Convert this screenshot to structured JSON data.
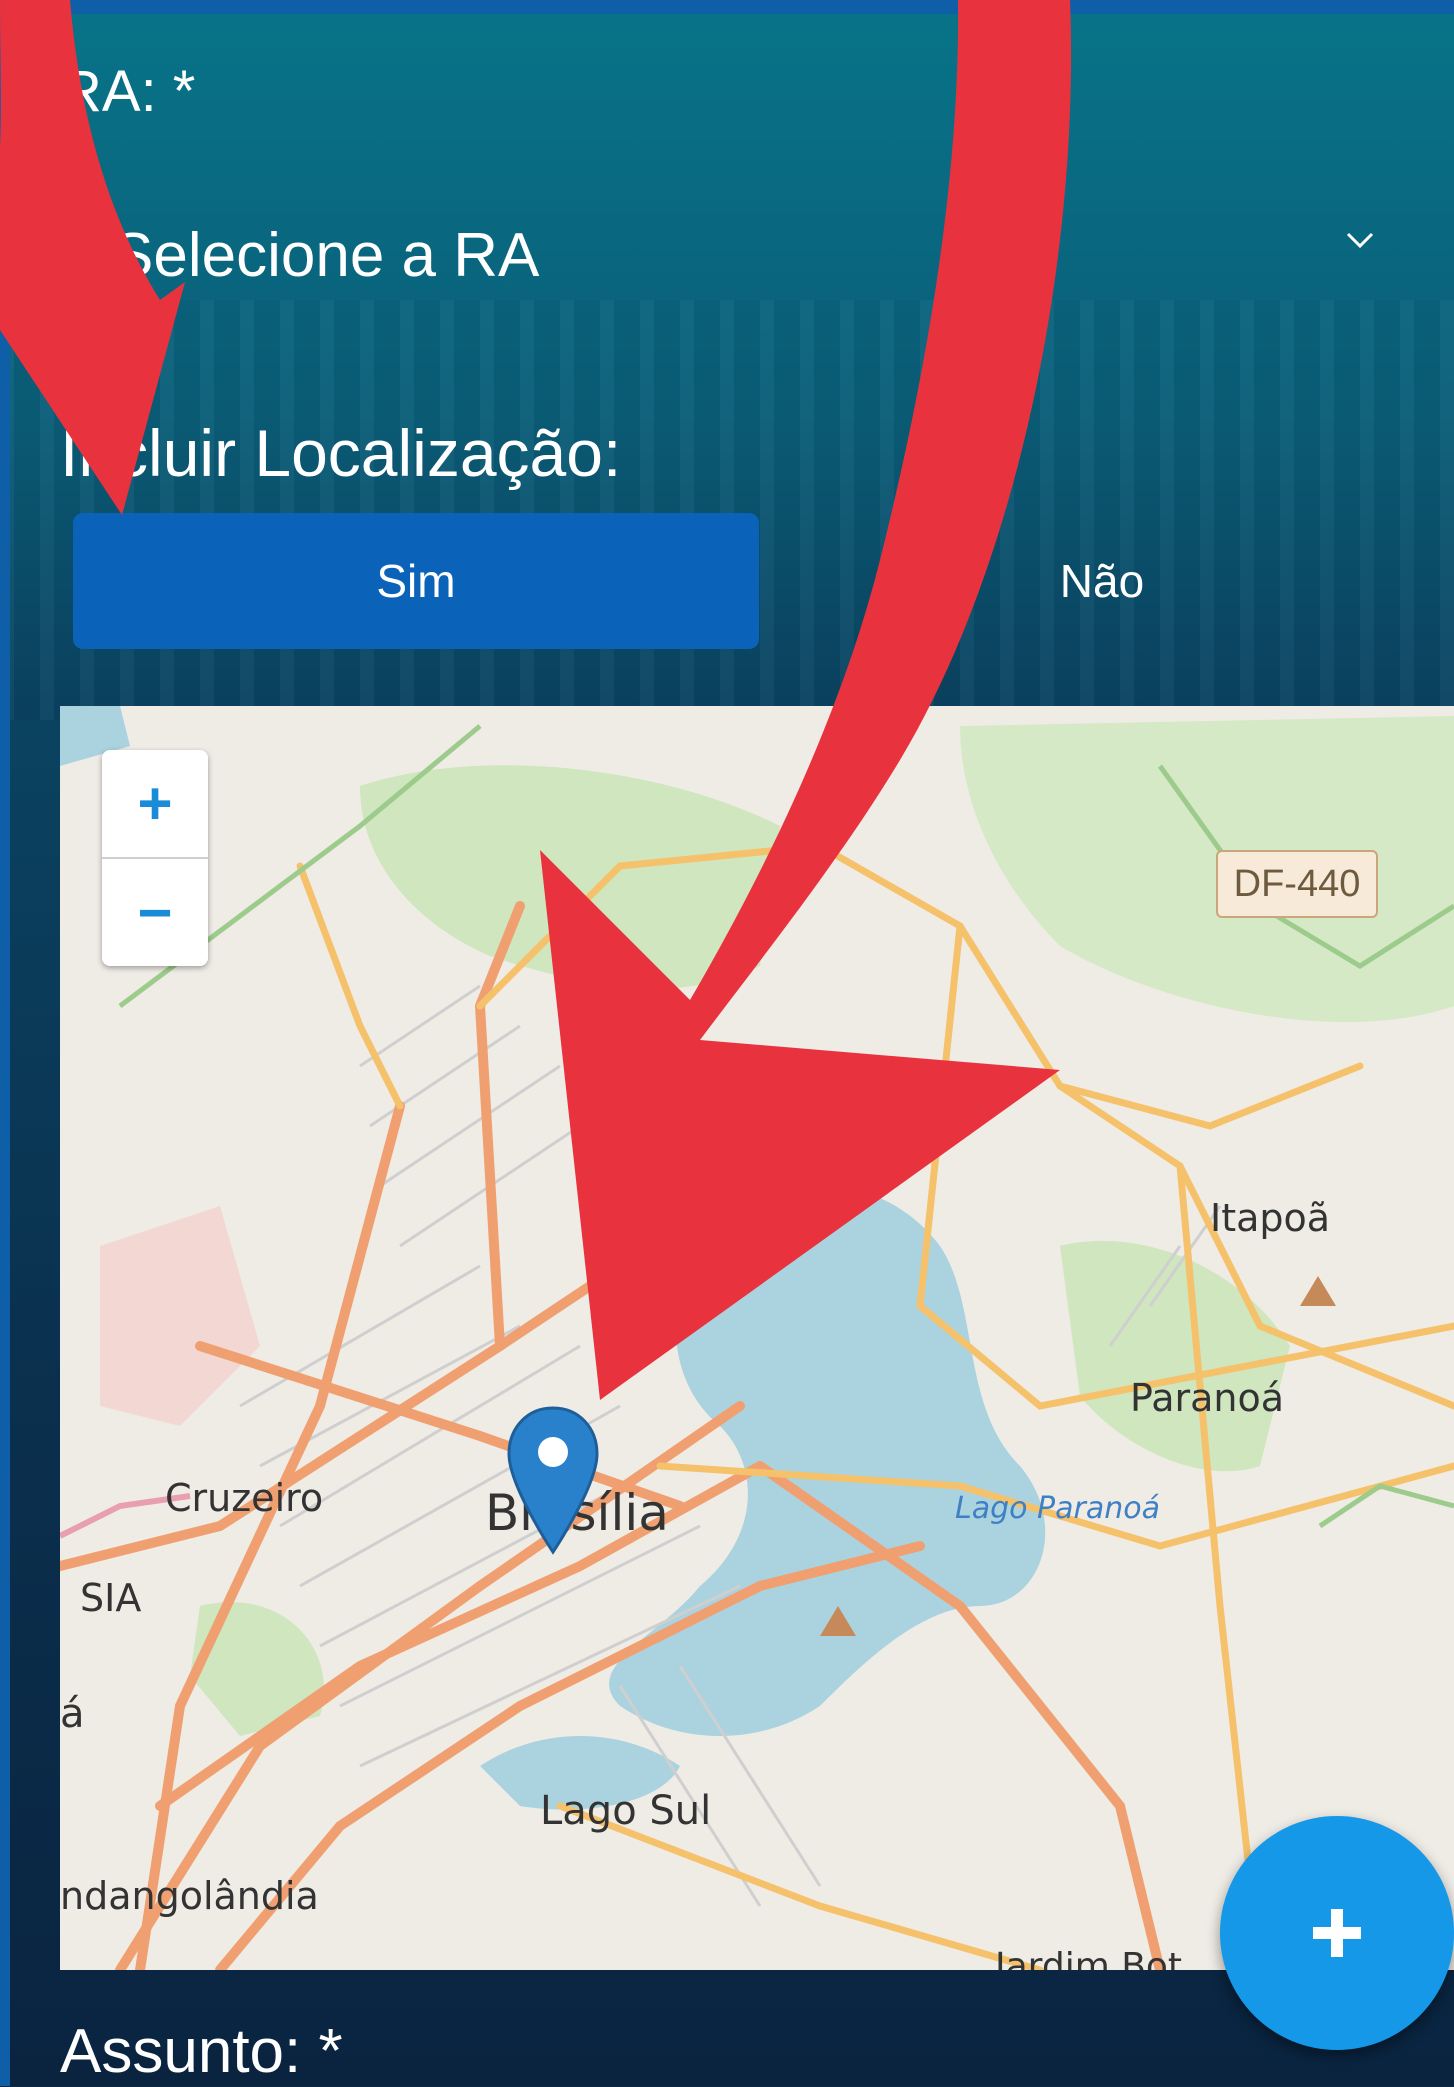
{
  "form": {
    "ra_label": "RA: *",
    "ra_select_value": "Selecione a RA",
    "location_label": "Incluir Localização:",
    "location_options": {
      "yes": "Sim",
      "no": "Não"
    },
    "location_selected": "Sim",
    "subject_label": "Assunto: *"
  },
  "map": {
    "zoom_in": "+",
    "zoom_out": "−",
    "road_shield": "DF-440",
    "places": {
      "itapoa": "Itapoã",
      "paranoa": "Paranoá",
      "brasilia": "Brasília",
      "cruzeiro": "Cruzeiro",
      "sia": "SIA",
      "lago_sul": "Lago Sul",
      "candangolandia": "ndangolândia",
      "jardim": "Jardim Bot",
      "guara": "á",
      "lago_paranoa": "Lago Paranoá"
    },
    "marker_icon": "map-pin-icon"
  },
  "fab": {
    "label": "+",
    "icon": "plus-icon",
    "color": "#1698e8"
  },
  "colors": {
    "accent": "#0a63b8",
    "annotation_arrow": "#e8333f"
  }
}
